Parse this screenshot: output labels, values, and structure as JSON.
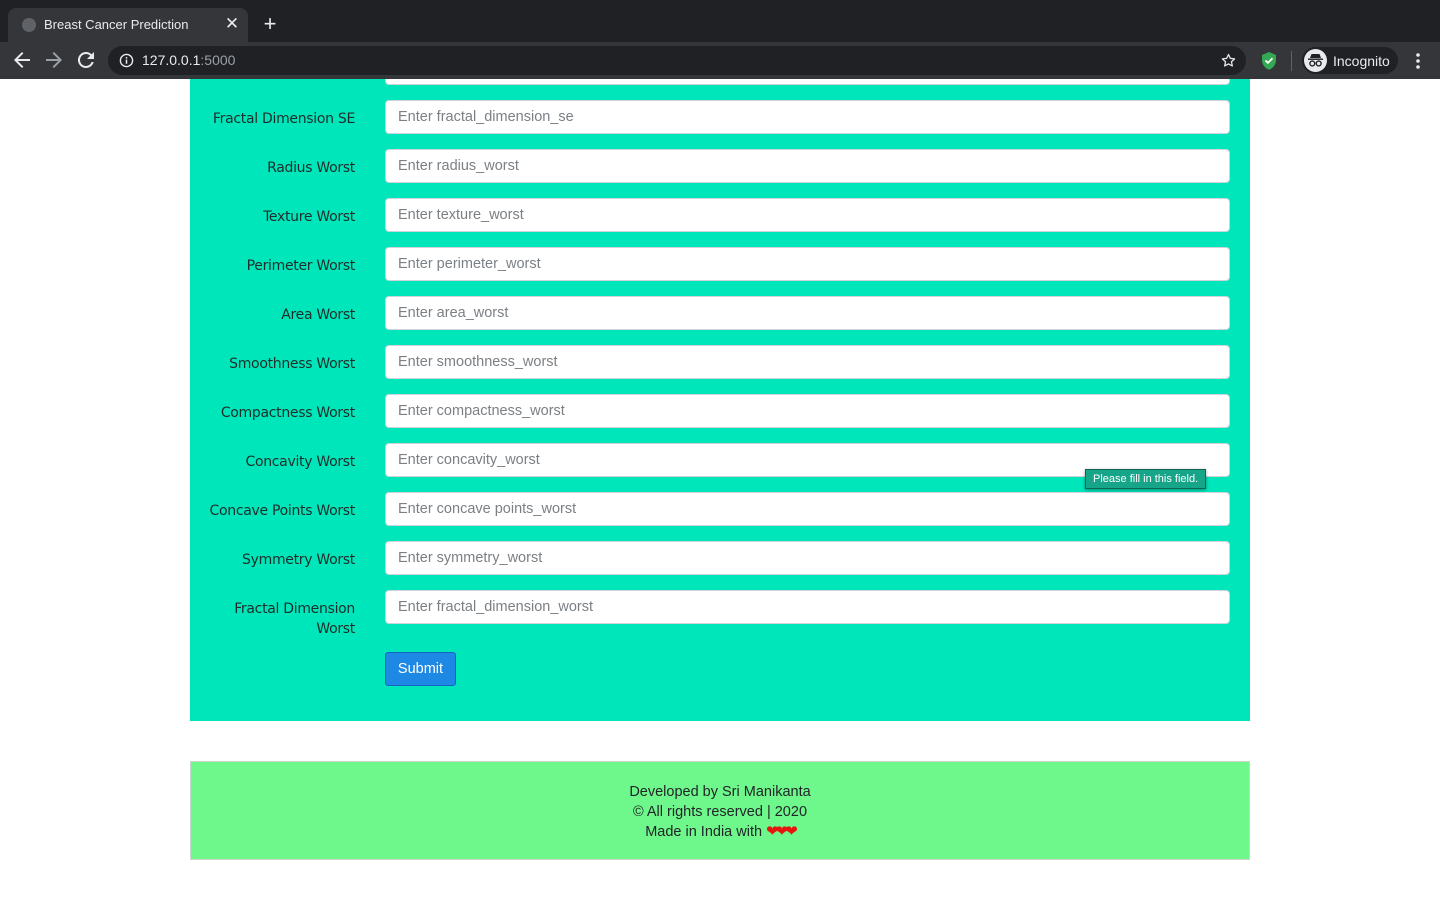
{
  "browser": {
    "tab_title": "Breast Cancer Prediction",
    "url_host": "127.0.0.1",
    "url_port": ":5000",
    "profile_label": "Incognito"
  },
  "form": {
    "fields": [
      {
        "label": "Fractal Dimension SE",
        "placeholder": "Enter fractal_dimension_se"
      },
      {
        "label": "Radius Worst",
        "placeholder": "Enter radius_worst"
      },
      {
        "label": "Texture Worst",
        "placeholder": "Enter texture_worst"
      },
      {
        "label": "Perimeter Worst",
        "placeholder": "Enter perimeter_worst"
      },
      {
        "label": "Area Worst",
        "placeholder": "Enter area_worst"
      },
      {
        "label": "Smoothness Worst",
        "placeholder": "Enter smoothness_worst"
      },
      {
        "label": "Compactness Worst",
        "placeholder": "Enter compactness_worst"
      },
      {
        "label": "Concavity Worst",
        "placeholder": "Enter concavity_worst"
      },
      {
        "label": "Concave Points Worst",
        "placeholder": "Enter concave points_worst"
      },
      {
        "label": "Symmetry Worst",
        "placeholder": "Enter symmetry_worst"
      },
      {
        "label": "Fractal Dimension Worst",
        "placeholder": "Enter fractal_dimension_worst"
      }
    ],
    "submit_label": "Submit",
    "validation_tooltip": "Please fill in this field."
  },
  "footer": {
    "line1": "Developed by Sri Manikanta",
    "line2": "© All rights reserved | 2020",
    "line3": "Made in India with",
    "hearts": "❤❤❤"
  },
  "colors": {
    "form_background": "#00e6bb",
    "footer_background": "#6ef78a",
    "submit_button": "#1e88e5"
  }
}
